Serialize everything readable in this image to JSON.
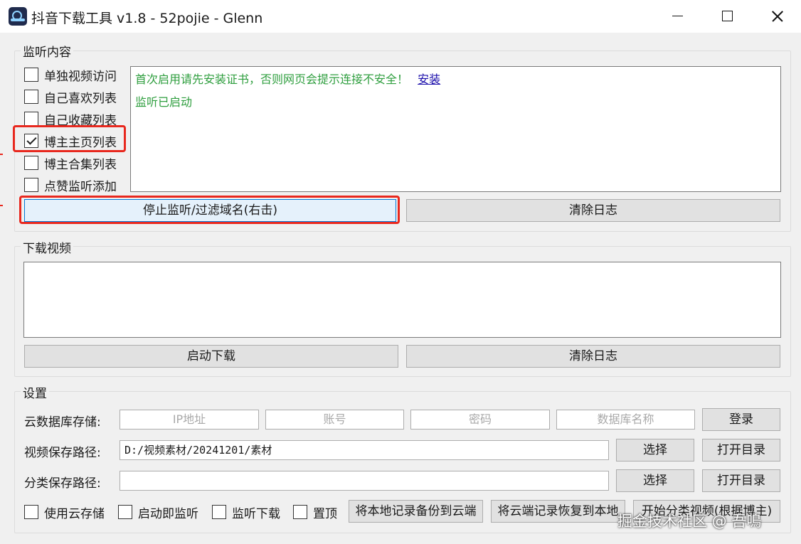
{
  "window": {
    "title": "抖音下载工具 v1.8 - 52pojie - Glenn"
  },
  "monitor": {
    "legend": "监听内容",
    "options": [
      {
        "label": "单独视频访问",
        "checked": false
      },
      {
        "label": "自己喜欢列表",
        "checked": false
      },
      {
        "label": "自己收藏列表",
        "checked": false
      },
      {
        "label": "博主主页列表",
        "checked": true
      },
      {
        "label": "博主合集列表",
        "checked": false
      },
      {
        "label": "点赞监听添加",
        "checked": false
      }
    ],
    "log_line1": "首次启用请先安装证书，否则网页会提示连接不安全！",
    "install_link": "安装",
    "log_line2": "监听已启动",
    "stop_button": "停止监听/过滤域名(右击)",
    "clear_button": "清除日志"
  },
  "download": {
    "legend": "下载视频",
    "start_button": "启动下载",
    "clear_button": "清除日志"
  },
  "settings": {
    "legend": "设置",
    "cloud_label": "云数据库存储:",
    "ip_placeholder": "IP地址",
    "account_placeholder": "账号",
    "password_placeholder": "密码",
    "dbname_placeholder": "数据库名称",
    "login_button": "登录",
    "video_path_label": "视频保存路径:",
    "video_path_value": "D:/视频素材/20241201/素材",
    "select_button": "选择",
    "open_dir_button": "打开目录",
    "category_path_label": "分类保存路径:",
    "category_path_value": "",
    "use_cloud": "使用云存储",
    "auto_monitor": "启动即监听",
    "monitor_download": "监听下载",
    "topmost": "置顶",
    "backup_button": "将本地记录备份到云端",
    "restore_button": "将云端记录恢复到本地",
    "classify_button": "开始分类视频(根据博主)"
  },
  "watermark": "掘金技术社区 @ 吾鳴",
  "colors": {
    "highlight": "#e8281e",
    "log_text": "#2e9e3e",
    "link": "#1a0dab",
    "focus_border": "#0078d7"
  }
}
